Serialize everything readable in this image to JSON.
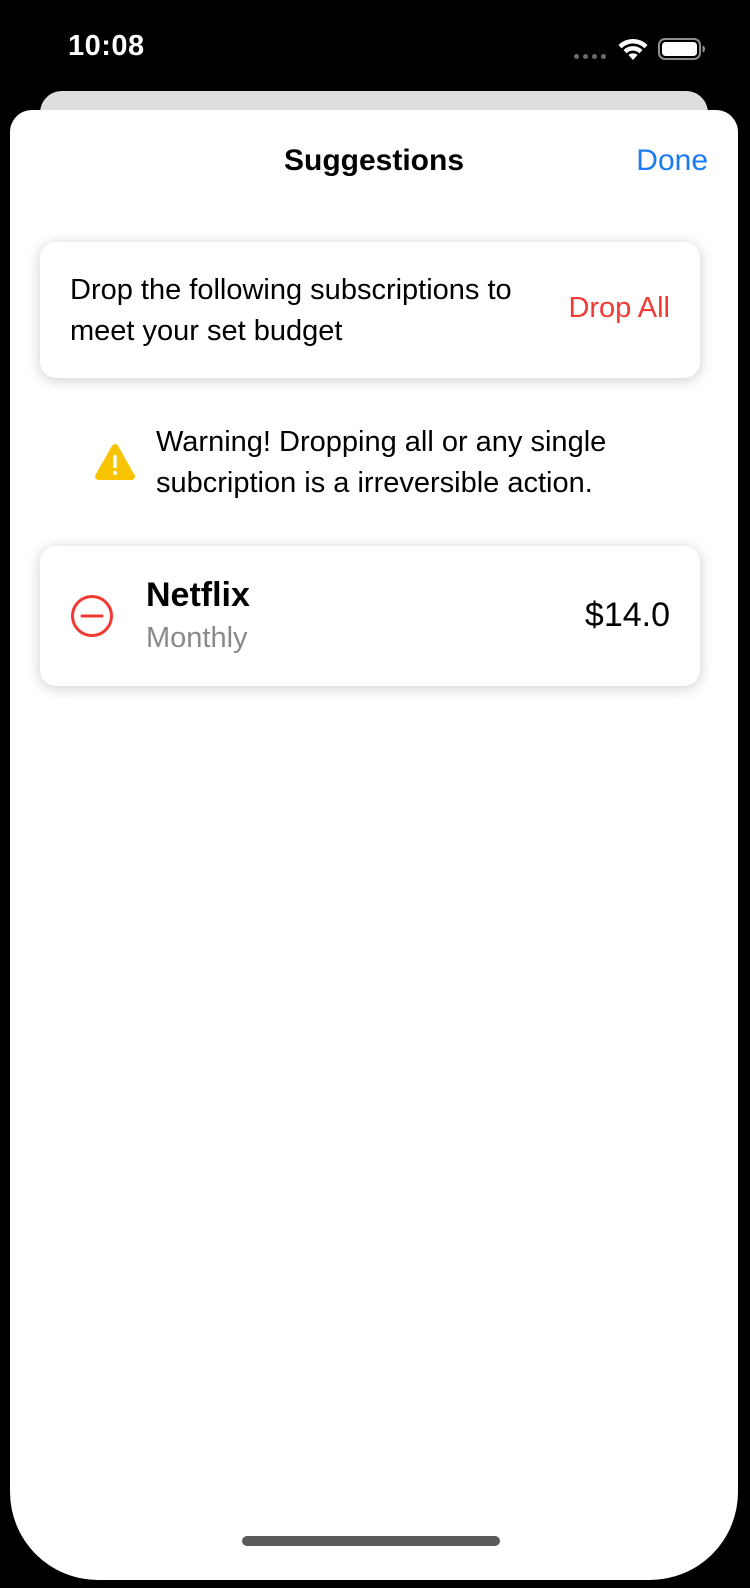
{
  "status_bar": {
    "time": "10:08"
  },
  "nav": {
    "title": "Suggestions",
    "done_label": "Done"
  },
  "budget_card": {
    "message": "Drop the following subscriptions to meet your set budget",
    "drop_all_label": "Drop All"
  },
  "warning": {
    "icon": "warning-triangle-icon",
    "text": "Warning! Dropping all or any single subcription is a irreversible action."
  },
  "subscriptions": [
    {
      "name": "Netflix",
      "period": "Monthly",
      "price": "$14.0",
      "icon": "minus-circle-icon"
    }
  ],
  "colors": {
    "accent_blue": "#1a7cf0",
    "destructive_red": "#ef3b33",
    "warning_yellow": "#f8c300",
    "secondary_text": "#8a8a8e"
  }
}
